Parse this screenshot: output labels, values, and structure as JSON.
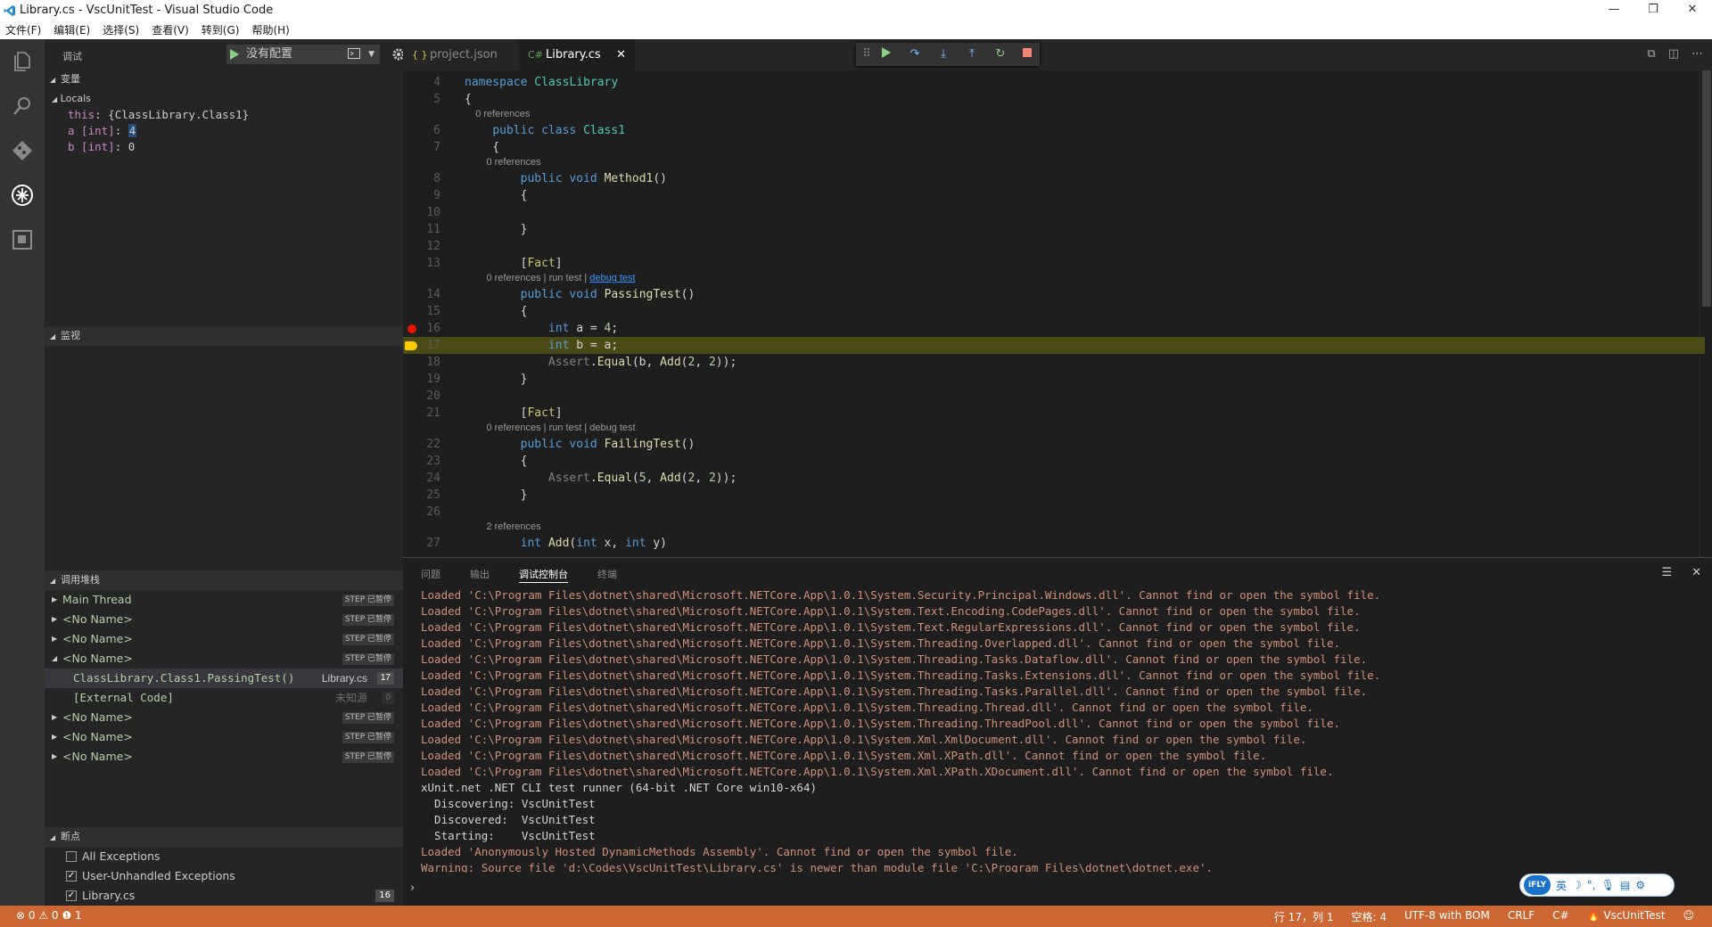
{
  "window": {
    "title": "Library.cs - VscUnitTest - Visual Studio Code",
    "minimize": "—",
    "restore": "❐",
    "close": "✕"
  },
  "menu": [
    "文件(F)",
    "编辑(E)",
    "选择(S)",
    "查看(V)",
    "转到(G)",
    "帮助(H)"
  ],
  "activity": [
    "files-icon",
    "search-icon",
    "git-icon",
    "debug-icon",
    "extensions-icon"
  ],
  "debug_header": {
    "label": "调试",
    "config": "没有配置"
  },
  "variables": {
    "title": "变量",
    "scope": "Locals",
    "items": [
      {
        "name": "this",
        "value": "{ClassLibrary.Class1}"
      },
      {
        "name": "a [int]",
        "value": "4"
      },
      {
        "name": "b [int]",
        "value": "0"
      }
    ]
  },
  "watch": {
    "title": "监视"
  },
  "callstack": {
    "title": "调用堆栈",
    "rows": [
      {
        "name": "Main Thread",
        "badge": "STEP 已暂停",
        "expanded": false
      },
      {
        "name": "<No Name>",
        "badge": "STEP 已暂停",
        "expanded": false
      },
      {
        "name": "<No Name>",
        "badge": "STEP 已暂停",
        "expanded": false
      },
      {
        "name": "<No Name>",
        "badge": "STEP 已暂停",
        "expanded": true
      }
    ],
    "frames": [
      {
        "name": "ClassLibrary.Class1.PassingTest()",
        "file": "Library.cs",
        "line": "17"
      },
      {
        "name": "[External Code]",
        "file": "未知源",
        "line": "0"
      }
    ],
    "more_rows": [
      {
        "name": "<No Name>",
        "badge": "STEP 已暂停"
      },
      {
        "name": "<No Name>",
        "badge": "STEP 已暂停"
      },
      {
        "name": "<No Name>",
        "badge": "STEP 已暂停"
      }
    ]
  },
  "breakpoints": {
    "title": "断点",
    "items": [
      {
        "label": "All Exceptions",
        "checked": false,
        "count": ""
      },
      {
        "label": "User-Unhandled Exceptions",
        "checked": true,
        "count": ""
      },
      {
        "label": "Library.cs",
        "checked": true,
        "count": "16"
      }
    ]
  },
  "tabs": [
    {
      "label": "project.json",
      "icon": "{ }"
    },
    {
      "label": "Library.cs",
      "icon": "C#",
      "close": "✕"
    }
  ],
  "code": {
    "lines": [
      {
        "n": "4",
        "html": "<span class=\"kw\">namespace</span> <span class=\"ty\">ClassLibrary</span>"
      },
      {
        "n": "5",
        "html": "{"
      },
      {
        "lens": "    0 references"
      },
      {
        "n": "6",
        "html": "    <span class=\"kw\">public</span> <span class=\"kw\">class</span> <span class=\"ty\">Class1</span>"
      },
      {
        "n": "7",
        "html": "    {"
      },
      {
        "lens": "        0 references"
      },
      {
        "n": "8",
        "html": "        <span class=\"kw\">public</span> <span class=\"kw\">void</span> <span class=\"fn\">Method1</span>()"
      },
      {
        "n": "9",
        "html": "        {"
      },
      {
        "n": "10",
        "html": ""
      },
      {
        "n": "11",
        "html": "        }"
      },
      {
        "n": "12",
        "html": ""
      },
      {
        "n": "13",
        "html": "        [<span class=\"at\">Fact</span>]"
      },
      {
        "lens": "        0 references | run test | ",
        "link": "debug test"
      },
      {
        "n": "14",
        "html": "        <span class=\"kw\">public</span> <span class=\"kw\">void</span> <span class=\"fn\">PassingTest</span>()"
      },
      {
        "n": "15",
        "html": "        {"
      },
      {
        "n": "16",
        "html": "            <span class=\"kw\">int</span> a = <span class=\"nm\">4</span>;",
        "bp": true
      },
      {
        "n": "17",
        "html": "            <span class=\"kw\">int</span> b = a;",
        "current": true
      },
      {
        "n": "18",
        "html": "            <span class=\"gr\">Assert</span>.<span class=\"fn\">Equal</span>(b, <span class=\"fn\">Add</span>(<span class=\"nm\">2</span>, <span class=\"nm\">2</span>));"
      },
      {
        "n": "19",
        "html": "        }"
      },
      {
        "n": "20",
        "html": ""
      },
      {
        "n": "21",
        "html": "        [<span class=\"at\">Fact</span>]"
      },
      {
        "lens": "        0 references | run test | debug test"
      },
      {
        "n": "22",
        "html": "        <span class=\"kw\">public</span> <span class=\"kw\">void</span> <span class=\"fn\">FailingTest</span>()"
      },
      {
        "n": "23",
        "html": "        {"
      },
      {
        "n": "24",
        "html": "            <span class=\"gr\">Assert</span>.<span class=\"fn\">Equal</span>(<span class=\"nm\">5</span>, <span class=\"fn\">Add</span>(<span class=\"nm\">2</span>, <span class=\"nm\">2</span>));"
      },
      {
        "n": "25",
        "html": "        }"
      },
      {
        "n": "26",
        "html": ""
      },
      {
        "lens": "        2 references"
      },
      {
        "n": "27",
        "html": "        <span class=\"kw\">int</span> <span class=\"fn\">Add</span>(<span class=\"kw\">int</span> x, <span class=\"kw\">int</span> y)"
      }
    ]
  },
  "panel": {
    "tabs": [
      "问题",
      "输出",
      "调试控制台",
      "终端"
    ],
    "active_tab": 2,
    "output": [
      {
        "t": "Loaded 'C:\\Program Files\\dotnet\\shared\\Microsoft.NETCore.App\\1.0.1\\System.Security.Principal.Windows.dll'. Cannot find or open the symbol file.",
        "c": "warn"
      },
      {
        "t": "Loaded 'C:\\Program Files\\dotnet\\shared\\Microsoft.NETCore.App\\1.0.1\\System.Text.Encoding.CodePages.dll'. Cannot find or open the symbol file.",
        "c": "warn"
      },
      {
        "t": "Loaded 'C:\\Program Files\\dotnet\\shared\\Microsoft.NETCore.App\\1.0.1\\System.Text.RegularExpressions.dll'. Cannot find or open the symbol file.",
        "c": "warn"
      },
      {
        "t": "Loaded 'C:\\Program Files\\dotnet\\shared\\Microsoft.NETCore.App\\1.0.1\\System.Threading.Overlapped.dll'. Cannot find or open the symbol file.",
        "c": "warn"
      },
      {
        "t": "Loaded 'C:\\Program Files\\dotnet\\shared\\Microsoft.NETCore.App\\1.0.1\\System.Threading.Tasks.Dataflow.dll'. Cannot find or open the symbol file.",
        "c": "warn"
      },
      {
        "t": "Loaded 'C:\\Program Files\\dotnet\\shared\\Microsoft.NETCore.App\\1.0.1\\System.Threading.Tasks.Extensions.dll'. Cannot find or open the symbol file.",
        "c": "warn"
      },
      {
        "t": "Loaded 'C:\\Program Files\\dotnet\\shared\\Microsoft.NETCore.App\\1.0.1\\System.Threading.Tasks.Parallel.dll'. Cannot find or open the symbol file.",
        "c": "warn"
      },
      {
        "t": "Loaded 'C:\\Program Files\\dotnet\\shared\\Microsoft.NETCore.App\\1.0.1\\System.Threading.Thread.dll'. Cannot find or open the symbol file.",
        "c": "warn"
      },
      {
        "t": "Loaded 'C:\\Program Files\\dotnet\\shared\\Microsoft.NETCore.App\\1.0.1\\System.Threading.ThreadPool.dll'. Cannot find or open the symbol file.",
        "c": "warn"
      },
      {
        "t": "Loaded 'C:\\Program Files\\dotnet\\shared\\Microsoft.NETCore.App\\1.0.1\\System.Xml.XmlDocument.dll'. Cannot find or open the symbol file.",
        "c": "warn"
      },
      {
        "t": "Loaded 'C:\\Program Files\\dotnet\\shared\\Microsoft.NETCore.App\\1.0.1\\System.Xml.XPath.dll'. Cannot find or open the symbol file.",
        "c": "warn"
      },
      {
        "t": "Loaded 'C:\\Program Files\\dotnet\\shared\\Microsoft.NETCore.App\\1.0.1\\System.Xml.XPath.XDocument.dll'. Cannot find or open the symbol file.",
        "c": "warn"
      },
      {
        "t": "xUnit.net .NET CLI test runner (64-bit .NET Core win10-x64)",
        "c": "norm"
      },
      {
        "t": "  Discovering: VscUnitTest",
        "c": "norm"
      },
      {
        "t": "  Discovered:  VscUnitTest",
        "c": "norm"
      },
      {
        "t": "  Starting:    VscUnitTest",
        "c": "norm"
      },
      {
        "t": "Loaded 'Anonymously Hosted DynamicMethods Assembly'. Cannot find or open the symbol file.",
        "c": "warn"
      },
      {
        "t": "Warning: Source file 'd:\\Codes\\VscUnitTest\\Library.cs' is newer than module file 'C:\\Program Files\\dotnet\\dotnet.exe'.",
        "c": "warn"
      }
    ],
    "prompt": "›"
  },
  "ifly": {
    "logo": "iFLY",
    "lang": "英",
    "items": [
      "☽",
      "°,",
      "🎙",
      "▤",
      "⚙"
    ]
  },
  "status": {
    "errors": "⊗ 0",
    "warnings": "⚠ 0",
    "info": "❶ 1",
    "position": "行 17，列 1",
    "indent": "空格: 4",
    "encoding": "UTF-8 with BOM",
    "eol": "CRLF",
    "lang": "C#",
    "project": "🔥 VscUnitTest",
    "feedback": "☺"
  },
  "colors": {
    "statusbar": "#cc6633",
    "activity": "#333333",
    "sidebar": "#252526",
    "editor": "#1e1e1e",
    "current_line": "#4b4b18",
    "breakpoint": "#e51400"
  }
}
